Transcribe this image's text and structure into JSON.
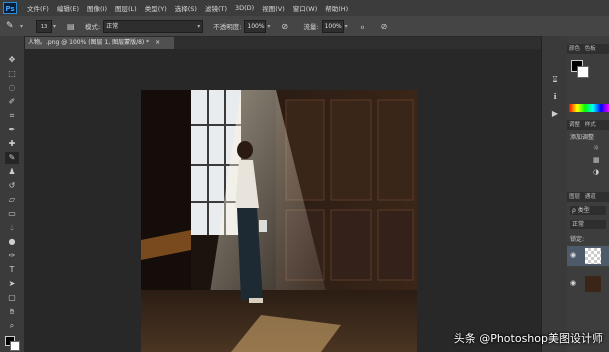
{
  "app": {
    "logo": "Ps"
  },
  "menu": [
    "文件(F)",
    "编辑(E)",
    "图像(I)",
    "图层(L)",
    "类型(Y)",
    "选择(S)",
    "滤镜(T)",
    "3D(D)",
    "视图(V)",
    "窗口(W)",
    "帮助(H)"
  ],
  "options": {
    "brush_size": "13",
    "mode_label": "模式:",
    "mode_value": "正常",
    "opacity_label": "不透明度:",
    "opacity_value": "100%",
    "flow_label": "流量:",
    "flow_value": "100%"
  },
  "document": {
    "tab_title": "人物。.png @ 100% (图层 1, 图层蒙版/8) *",
    "tab_close": "×"
  },
  "panels": {
    "color_tab": "颜色",
    "color_tab2": "色板",
    "adjust_tab": "调整",
    "adjust_tab2": "样式",
    "add_adjust": "添加调整",
    "layers_tab": "图层",
    "layers_tab2": "通道",
    "kind_label": "ρ 类型",
    "blend_mode": "正常",
    "lock_label": "锁定:"
  },
  "watermark": "头条 @Photoshop美图设计师"
}
